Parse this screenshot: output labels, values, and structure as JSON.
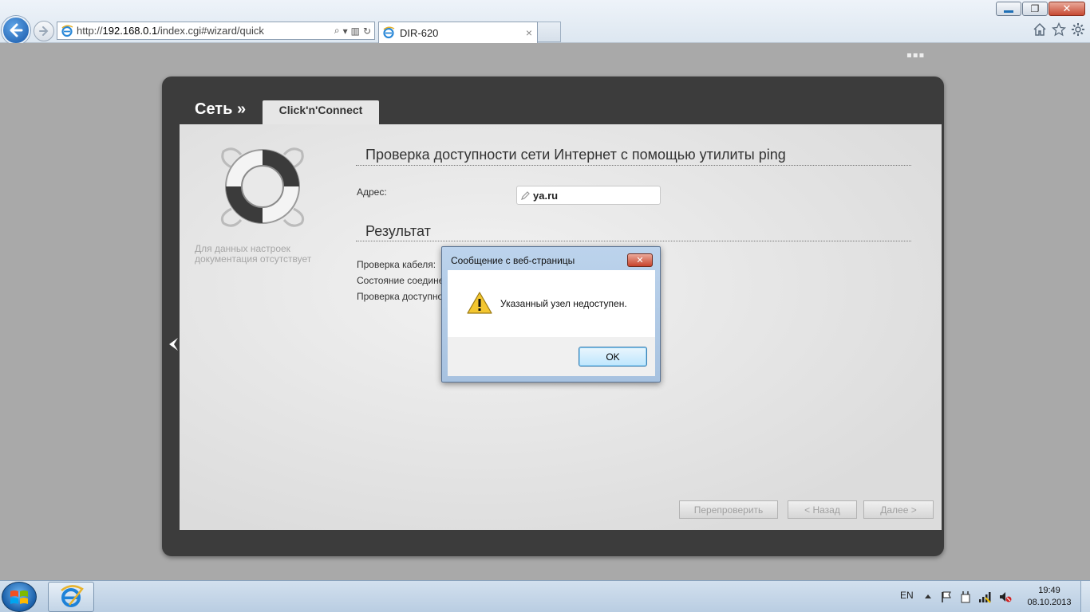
{
  "browser": {
    "url_prefix": "http://",
    "url_host": "192.168.0.1",
    "url_path": "/index.cgi#wizard/quick",
    "tab_title": "DIR-620",
    "tab_close": "×",
    "dots": "▪▪▪"
  },
  "router": {
    "section_label": "Сеть »",
    "tab_label": "Click'n'Connect",
    "side_note": "Для данных настроек документация отсутствует",
    "ping_heading": "Проверка доступности сети Интернет с помощью утилиты ping",
    "address_label": "Адрес:",
    "address_value": "ya.ru",
    "result_heading": "Результат",
    "result_rows": [
      "Проверка кабеля:",
      "Состояние соедине",
      "Проверка доступно"
    ],
    "buttons": {
      "recheck": "Перепроверить",
      "back": "< Назад",
      "next": "Далее >"
    }
  },
  "dialog": {
    "title": "Сообщение с веб-страницы",
    "message": "Указанный узел недоступен.",
    "ok_label": "OK",
    "close_glyph": "✕"
  },
  "taskbar": {
    "lang": "EN",
    "time": "19:49",
    "date": "08.10.2013"
  },
  "colors": {
    "ie_blue": "#1e6fb5",
    "panel_dark": "#3c3c3c",
    "content_bg": "#e8e8e8",
    "close_red": "#c7432c"
  }
}
